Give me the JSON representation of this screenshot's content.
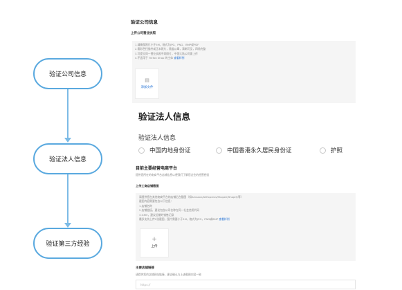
{
  "flow": {
    "steps": [
      "验证公司信息",
      "验证法人信息",
      "验证第三方经验"
    ]
  },
  "company": {
    "title": "验证公司信息",
    "license_label": "上传公司营业执照",
    "notes": [
      "1.请确保照片小于5M，格式为JPG、PNG、BMP或PDF",
      "2.需彩色扫描件或正本照片，需盖公章，清晰可见，四角完整",
      "3.可提交同一营业执照不同照片，中国大陆公司需上传",
      "4.不适用于 TikTok Shop 的主体"
    ],
    "notes_link": "查看样例",
    "upload_label": "添加文件",
    "upload_icon": "upload-file-icon"
  },
  "legal": {
    "title": "验证法人信息",
    "subtitle": "验证法人信息",
    "options": [
      "中国内地身份证",
      "中国香港永久居民身份证",
      "护照"
    ]
  },
  "platform": {
    "title": "目前主要经营电商平台",
    "desc": "提供您所在的电商平台店铺信息以便我们了解您过往的经营经验",
    "screenshot_label": "上传工商店铺截图",
    "notes": [
      "请提供您在其他电商平台的店铺后台截图（如Amazon/AliExpress/Shopee/Shopify等）",
      "截图内容需要包含以下信息：",
      "1.店铺名称",
      "2.店铺链接，建议包含公司名称在同一社会信用代码",
      "3.GMV，建议近期的销售记录",
      "最多支持上传9张截图，图片需要小于5M，格式为JPG，PNG或BMP"
    ],
    "notes_link": "查看样例",
    "upload_label": "上传",
    "upload_icon": "plus-icon",
    "link_label": "主要店铺链接",
    "link_desc": "请提供您的店铺网站链接，建议确认与上述截图内容一致",
    "link_placeholder": "https://"
  },
  "colors": {
    "flow_border": "#5aa9df",
    "flow_line": "#7cbbe6",
    "link": "#2a76d6"
  }
}
